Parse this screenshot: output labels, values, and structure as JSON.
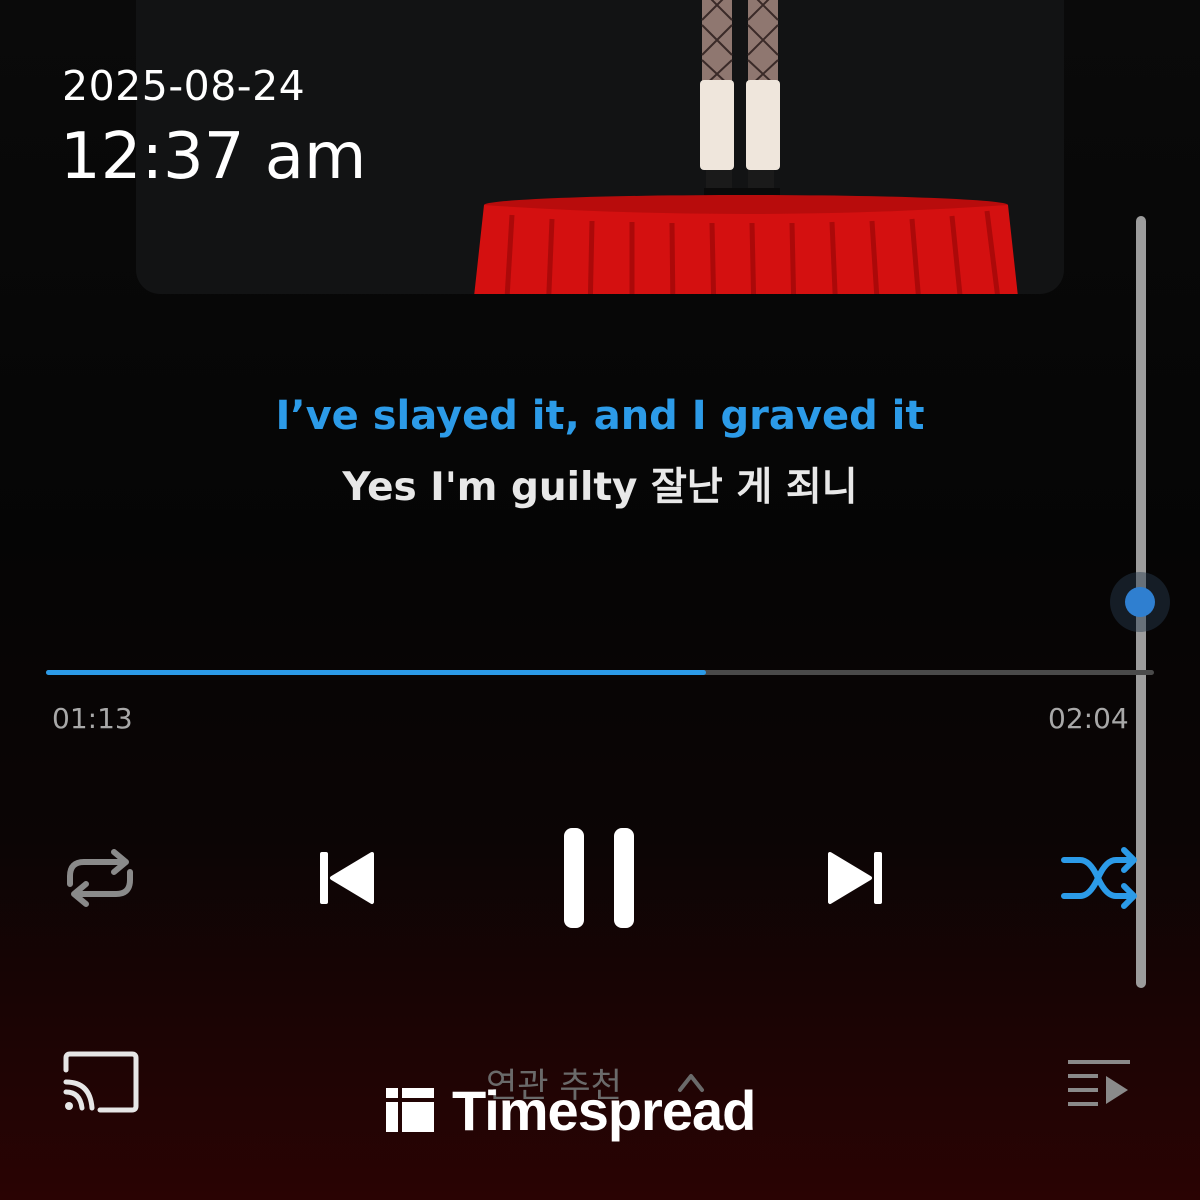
{
  "status": {
    "date": "2025-08-24",
    "time": "12:37 am"
  },
  "lyrics": {
    "current_line": "I’ve slayed it, and I graved it",
    "next_line": "Yes I'm guilty 잘난 게 죄니"
  },
  "playback": {
    "elapsed": "01:13",
    "total": "02:04",
    "progress_fraction": 0.596
  },
  "controls": {
    "repeat": "repeat-icon",
    "previous": "skip-previous-icon",
    "pause": "pause-icon",
    "next": "skip-next-icon",
    "shuffle": "shuffle-icon",
    "shuffle_active": true
  },
  "bottom_bar": {
    "recommend_label": "연관 추천",
    "cast": "cast-icon",
    "queue": "queue-icon"
  },
  "watermark": {
    "brand": "Timespread"
  },
  "colors": {
    "accent": "#2c9be8",
    "lyric_next": "#e8e8e8",
    "time_gray": "#a8a8a8",
    "track_gray": "#4a4a4a",
    "album_table_red": "#d41010"
  }
}
